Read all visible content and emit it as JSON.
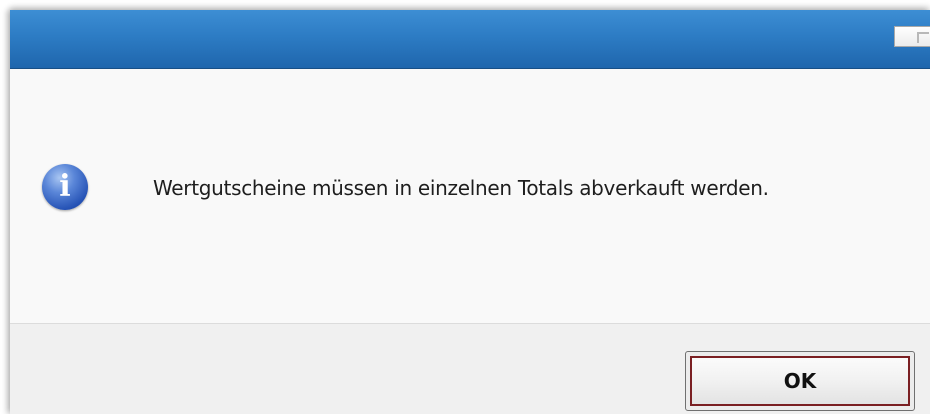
{
  "dialog": {
    "icon": "information-icon",
    "icon_glyph": "i",
    "message": "Wertgutscheine müssen in einzelnen Totals abverkauft werden.",
    "ok_label": "OK"
  },
  "titlebar": {
    "control_icon": "window-control-icon"
  },
  "colors": {
    "titlebar": "#2d7cc4",
    "content_background": "#f9f9f9",
    "footer_background": "#f0f0f0",
    "button_focus_border": "#7a1f22"
  }
}
